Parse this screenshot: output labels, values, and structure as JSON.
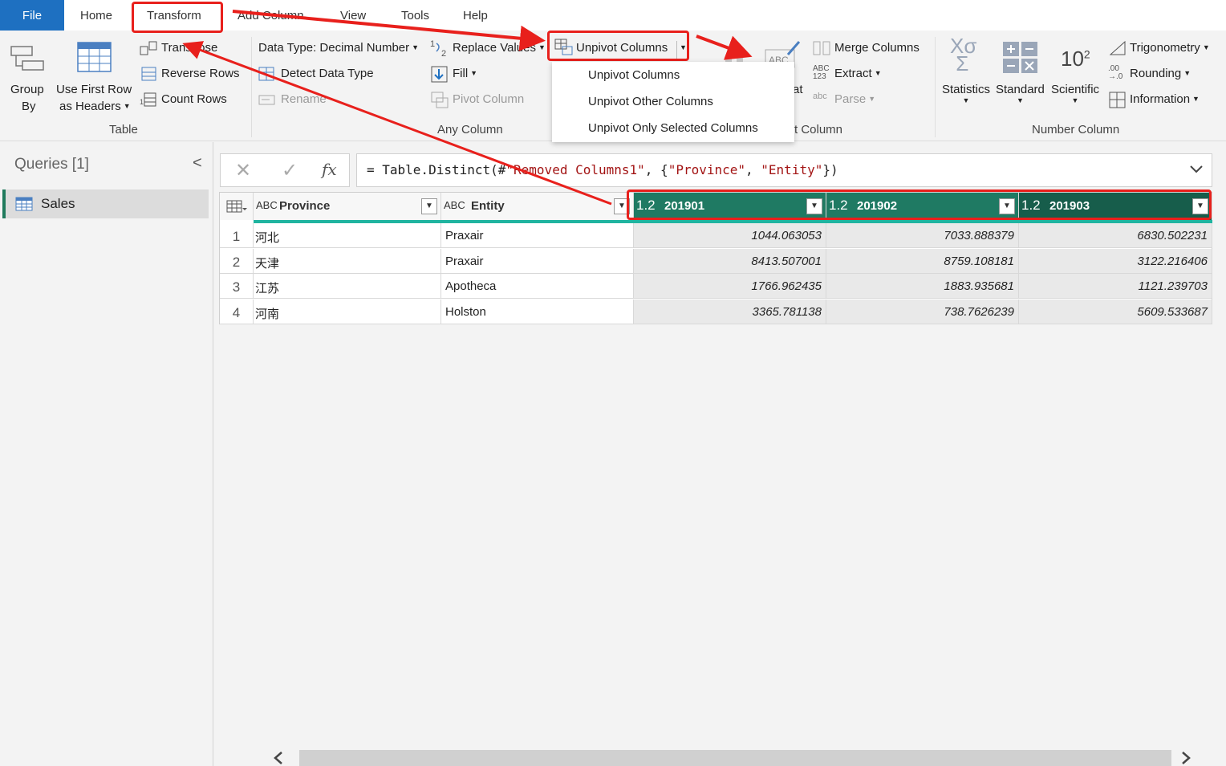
{
  "menu": {
    "file": "File",
    "home": "Home",
    "transform": "Transform",
    "add_column": "Add Column",
    "view": "View",
    "tools": "Tools",
    "help": "Help"
  },
  "ribbon": {
    "table": {
      "group_by_1": "Group",
      "group_by_2": "By",
      "first_row_1": "Use First Row",
      "first_row_2": "as Headers",
      "transpose": "Transpose",
      "reverse_rows": "Reverse Rows",
      "count_rows": "Count Rows",
      "label": "Table"
    },
    "any_column": {
      "data_type": "Data Type: Decimal Number",
      "detect": "Detect Data Type",
      "rename": "Rename",
      "replace": "Replace Values",
      "fill": "Fill",
      "pivot": "Pivot Column",
      "unpivot": "Unpivot Columns",
      "label": "Any Column"
    },
    "text_column": {
      "format_partial": "at",
      "merge": "Merge Columns",
      "extract": "Extract",
      "parse": "Parse",
      "label_partial": "t Column"
    },
    "number_column": {
      "statistics": "Statistics",
      "standard": "Standard",
      "scientific": "Scientific",
      "trig": "Trigonometry",
      "rounding": "Rounding",
      "information": "Information",
      "label": "Number Column"
    }
  },
  "dropdown": {
    "items": [
      "Unpivot Columns",
      "Unpivot Other Columns",
      "Unpivot Only Selected Columns"
    ]
  },
  "queries": {
    "title": "Queries [1]",
    "collapse": "<",
    "items": [
      "Sales"
    ]
  },
  "formula": {
    "cancel": "✕",
    "commit": "✓",
    "fx": "fx",
    "text": "= Table.Distinct(#\"Removed Columns1\", {\"Province\", \"Entity\"})"
  },
  "table": {
    "columns": [
      {
        "type": "ABC",
        "name": "Province"
      },
      {
        "type": "ABC",
        "name": "Entity"
      },
      {
        "type": "1.2",
        "name": "201901"
      },
      {
        "type": "1.2",
        "name": "201902"
      },
      {
        "type": "1.2",
        "name": "201903"
      }
    ],
    "rows": [
      [
        "1",
        "河北",
        "Praxair",
        "1044.063053",
        "7033.888379",
        "6830.502231"
      ],
      [
        "2",
        "天津",
        "Praxair",
        "8413.507001",
        "8759.108181",
        "3122.216406"
      ],
      [
        "3",
        "江苏",
        "Apotheca",
        "1766.962435",
        "1883.935681",
        "1121.239703"
      ],
      [
        "4",
        "河南",
        "Holston",
        "3365.781138",
        "738.7626239",
        "5609.533687"
      ]
    ]
  },
  "colors": {
    "accent": "#1f7a63",
    "file_tab": "#1e70c1",
    "annotation": "#e8201c"
  }
}
